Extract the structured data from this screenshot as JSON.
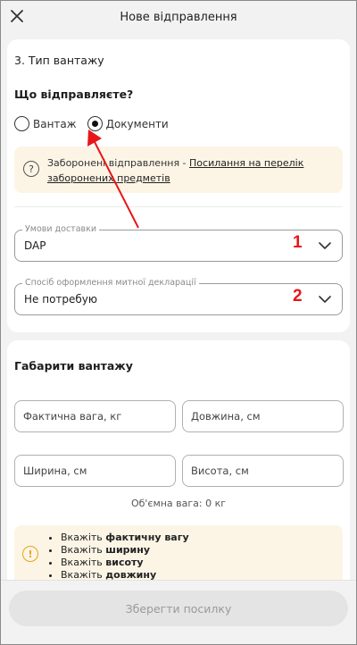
{
  "header": {
    "title": "Нове відправлення",
    "close_icon": "close-icon"
  },
  "cargo_type": {
    "section_title": "3. Тип вантажу",
    "question": "Що відправляєте?",
    "options": [
      {
        "label": "Вантаж",
        "selected": false
      },
      {
        "label": "Документи",
        "selected": true
      }
    ],
    "banner": {
      "icon": "question-icon",
      "text": "Заборонені відправлення - ",
      "link": "Посилання на перелік заборонених предметів"
    },
    "delivery_terms": {
      "label": "Умови доставки",
      "value": "DAP",
      "badge": "1"
    },
    "customs": {
      "label": "Спосіб оформлення митної декларації",
      "value": "Не потребую",
      "badge": "2"
    }
  },
  "dimensions": {
    "section_title": "Габарити вантажу",
    "fields": {
      "weight": "Фактична вага, кг",
      "length": "Довжина, см",
      "width": "Ширина, см",
      "height": "Висота, см"
    },
    "volume_weight": "Об'ємна вага: 0 кг",
    "tips": {
      "icon": "warning-icon",
      "items": [
        {
          "prefix": "Вкажіть ",
          "bold": "фактичну вагу"
        },
        {
          "prefix": "Вкажіть ",
          "bold": "ширину"
        },
        {
          "prefix": "Вкажіть ",
          "bold": "висоту"
        },
        {
          "prefix": "Вкажіть ",
          "bold": "довжину"
        }
      ]
    }
  },
  "footer": {
    "save_label": "Зберегти посилку"
  },
  "colors": {
    "annotation": "#e8151a",
    "banner_bg": "#fcf5e6",
    "warning": "#e8a317"
  }
}
